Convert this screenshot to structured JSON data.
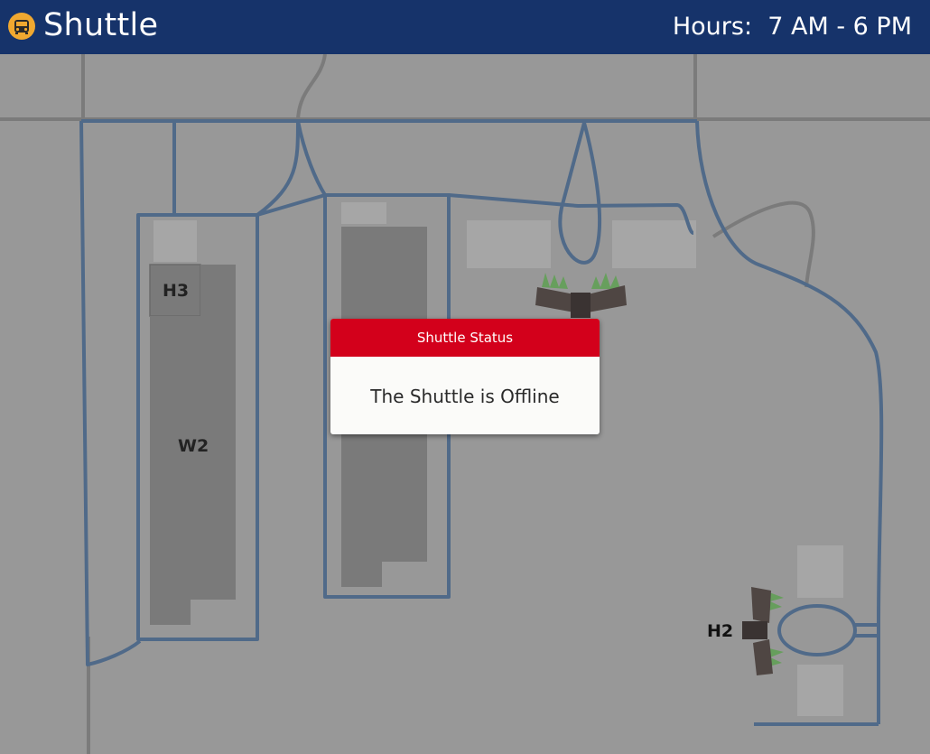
{
  "header": {
    "app_title": "Shuttle",
    "hours_text": "Hours:  7 AM - 6 PM",
    "logo_icon": "shuttle-bus-icon"
  },
  "map": {
    "labels": {
      "h3": "H3",
      "w2": "W2",
      "h2": "H2"
    },
    "colors": {
      "background": "#989898",
      "route": "#506a89",
      "street": "#7b7b7b",
      "building": "#7a7a7a",
      "lot": "#a6a6a6"
    }
  },
  "status_modal": {
    "title": "Shuttle Status",
    "message": "The Shuttle is Offline",
    "header_color": "#d3001b"
  },
  "theme": {
    "header_bg": "#16336a"
  }
}
